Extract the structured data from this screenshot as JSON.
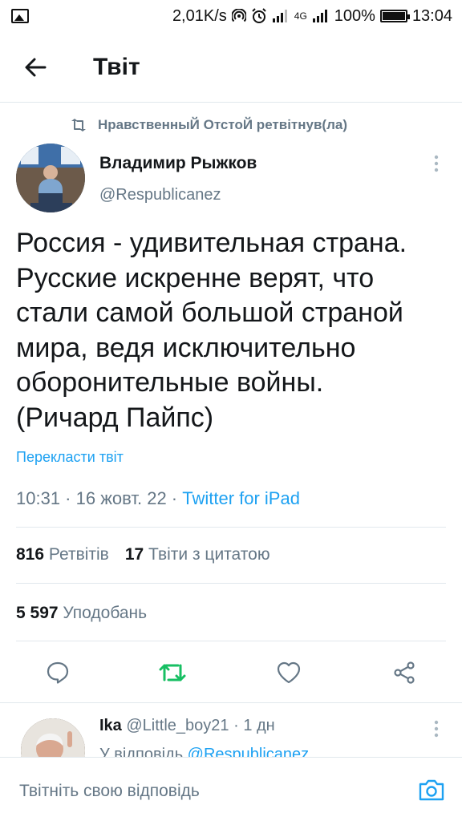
{
  "status_bar": {
    "speed": "2,01K/s",
    "network": "4G",
    "battery": "100%",
    "time": "13:04"
  },
  "header": {
    "title": "Твіт"
  },
  "retweet": {
    "text": "НравственныЙ ОтстоЙ ретвітнув(ла)"
  },
  "author": {
    "name": "Владимир Рыжков",
    "handle": "@Respublicanez"
  },
  "tweet": {
    "text": "Россия - удивительная страна.\nРусские искренне верят, что\nстали самой большой страной\nмира, ведя исключительно\nоборонительные войны.\n(Ричард Пайпс)",
    "translate_label": "Перекласти твіт",
    "time": "10:31 · 16 жовт. 22 · ",
    "source": "Twitter for iPad"
  },
  "stats": {
    "retweets_count": "816",
    "retweets_label": "Ретвітів",
    "quotes_count": "17",
    "quotes_label": "Твіти з цитатою",
    "likes_count": "5 597",
    "likes_label": "Уподобань"
  },
  "actions": [
    "reply-icon",
    "retweet-icon",
    "like-icon",
    "share-icon"
  ],
  "colors": {
    "accent": "#1da1f2",
    "retweet_green": "#17bf63",
    "muted": "#657786"
  },
  "reply_preview": {
    "name": "Ika",
    "handle": "@Little_boy21",
    "time": " · 1 дн",
    "prefix": "У відповідь ",
    "mention": "@Respublicanez"
  },
  "composer": {
    "placeholder": "Твітніть свою відповідь"
  }
}
